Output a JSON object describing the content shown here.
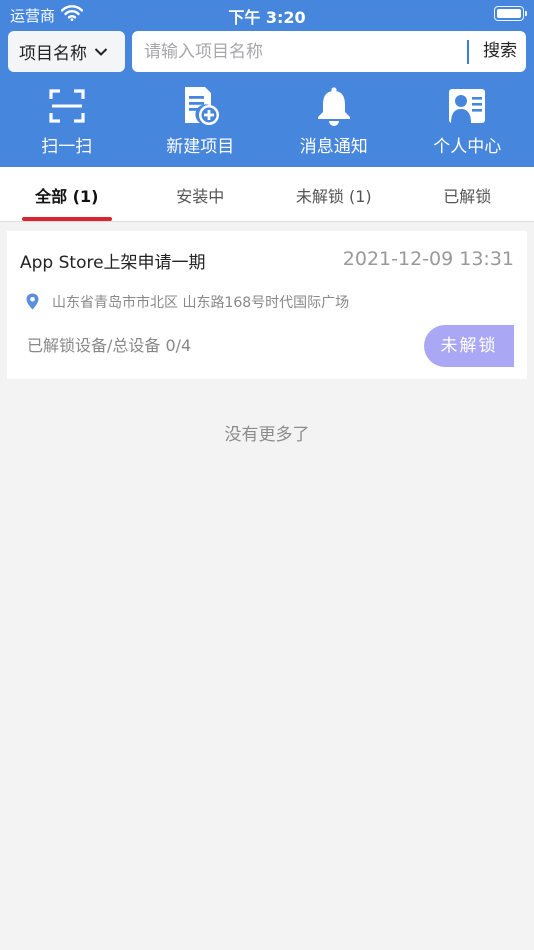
{
  "status_bar": {
    "carrier": "运营商",
    "time": "下午 3:20"
  },
  "search": {
    "type_label": "项目名称",
    "placeholder": "请输入项目名称",
    "button_label": "搜索"
  },
  "actions": [
    {
      "label": "扫一扫",
      "icon": "scan-icon"
    },
    {
      "label": "新建项目",
      "icon": "new-document-icon"
    },
    {
      "label": "消息通知",
      "icon": "bell-icon"
    },
    {
      "label": "个人中心",
      "icon": "profile-card-icon"
    }
  ],
  "tabs": [
    {
      "label": "全部 (1)",
      "active": true
    },
    {
      "label": "安装中",
      "active": false
    },
    {
      "label": "未解锁 (1)",
      "active": false
    },
    {
      "label": "已解锁",
      "active": false
    }
  ],
  "projects": [
    {
      "name": "App Store上架申请一期",
      "datetime": "2021-12-09 13:31",
      "address": "山东省青岛市市北区 山东路168号时代国际广场",
      "devices_text": "已解锁设备/总设备  0/4",
      "status_label": "未解锁"
    }
  ],
  "list_end_text": "没有更多了",
  "colors": {
    "header_bg": "#4786dd",
    "tab_indicator": "#d9232e",
    "status_button": "#aaa8f4",
    "page_bg": "#f3f3f4"
  }
}
